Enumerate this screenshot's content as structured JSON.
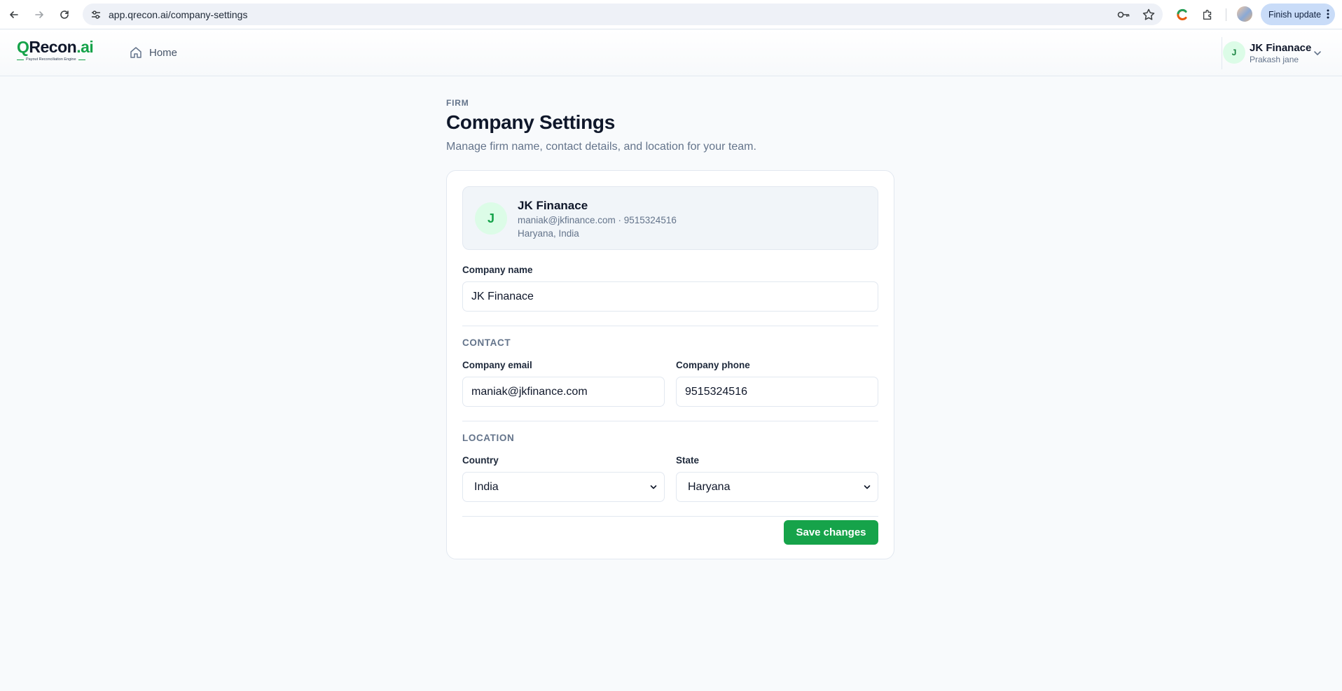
{
  "browser": {
    "url": "app.qrecon.ai/company-settings",
    "update_label": "Finish update"
  },
  "app": {
    "logo": {
      "q": "Q",
      "main": "Recon",
      "ai": ".ai",
      "tagline": "Payout Reconciliation Engine"
    },
    "nav": {
      "home_label": "Home"
    },
    "user": {
      "initial": "J",
      "name": "JK Finanace",
      "subtitle": "Prakash jane"
    }
  },
  "page": {
    "eyebrow": "FIRM",
    "title": "Company Settings",
    "description": "Manage firm name, contact details, and location for your team."
  },
  "summary": {
    "initial": "J",
    "name": "JK Finanace",
    "contact": "maniak@jkfinance.com · 9515324516",
    "location": "Haryana, India"
  },
  "form": {
    "company_name": {
      "label": "Company name",
      "value": "JK Finanace"
    },
    "contact_section": "CONTACT",
    "email": {
      "label": "Company email",
      "value": "maniak@jkfinance.com"
    },
    "phone": {
      "label": "Company phone",
      "value": "9515324516"
    },
    "location_section": "LOCATION",
    "country": {
      "label": "Country",
      "value": "India"
    },
    "state": {
      "label": "State",
      "value": "Haryana"
    },
    "save_label": "Save changes"
  },
  "colors": {
    "accent": "#16a34a",
    "accent_light": "#dcfce7",
    "muted": "#64748b"
  }
}
